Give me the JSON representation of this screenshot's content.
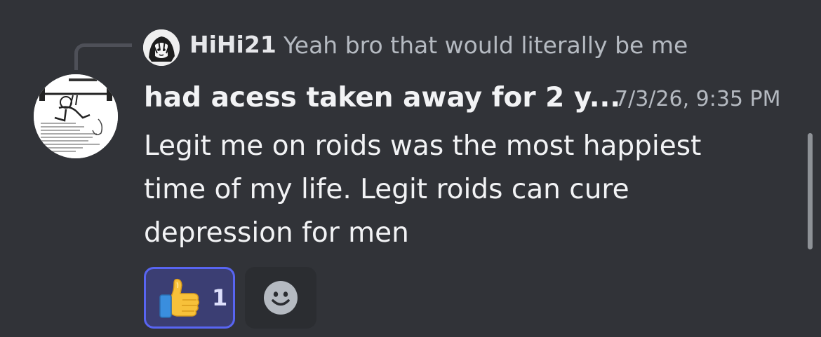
{
  "reply": {
    "author": "HiHi21",
    "text": "Yeah bro that would literally be me",
    "avatar_icon": "manga-avatar-icon"
  },
  "message": {
    "author": "had acess taken away for 2 y...",
    "timestamp": "7/3/26, 9:35 PM",
    "lines": [
      "Legit me on roids was the most happiest",
      "time of my life. Legit roids can cure",
      "depression for men"
    ],
    "avatar_icon": "workout-sketch-avatar-icon"
  },
  "reactions": [
    {
      "emoji": "thumbs-up-icon",
      "count": "1",
      "selected": true
    }
  ],
  "add_reaction": {
    "icon": "smiley-add-reaction-icon"
  },
  "colors": {
    "background": "#313338",
    "selected_reaction_border": "#5865f2",
    "selected_reaction_bg": "#3b3e73",
    "muted_text": "#b5bac1"
  }
}
